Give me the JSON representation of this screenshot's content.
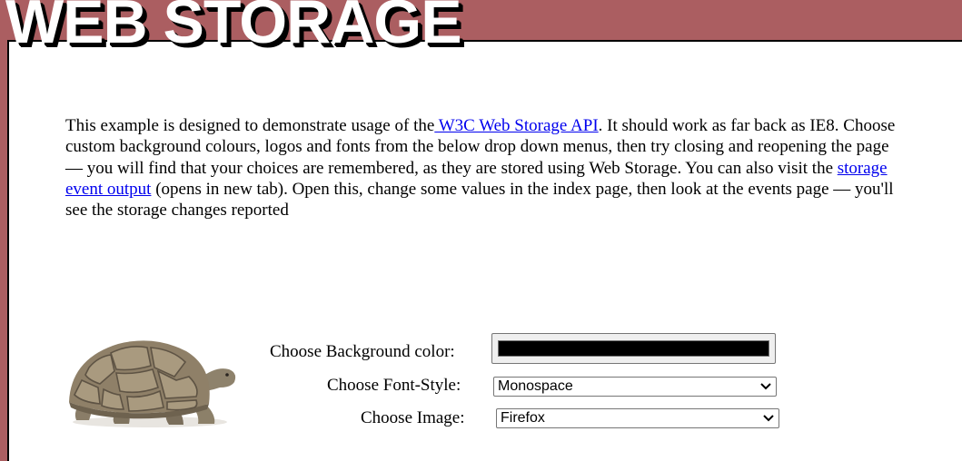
{
  "header": {
    "title": "WEB STORAGE"
  },
  "intro": {
    "text_1": "This example is designed to demonstrate usage of the",
    "link_api": " W3C Web Storage API",
    "text_2": ". It should work as far back as IE8. Choose custom background colours, logos and fonts from the below drop down menus, then try closing and reopening the page — you will find that your choices are remembered, as they are stored using Web Storage. You can also visit the ",
    "link_events": "storage event output",
    "text_3": " (opens in new tab). Open this, change some values in the index page, then look at the events page — you'll see the storage changes reported"
  },
  "form": {
    "bg_label": "Choose Background color:",
    "bg_value": "#000000",
    "font_label": "Choose Font-Style:",
    "font_value": "Monospace",
    "image_label": "Choose Image:",
    "image_value": "Firefox"
  },
  "image": {
    "icon": "tortoise-image"
  },
  "colors": {
    "band": "#ab5e61",
    "link": "#0000ee",
    "swatch": "#000000"
  }
}
